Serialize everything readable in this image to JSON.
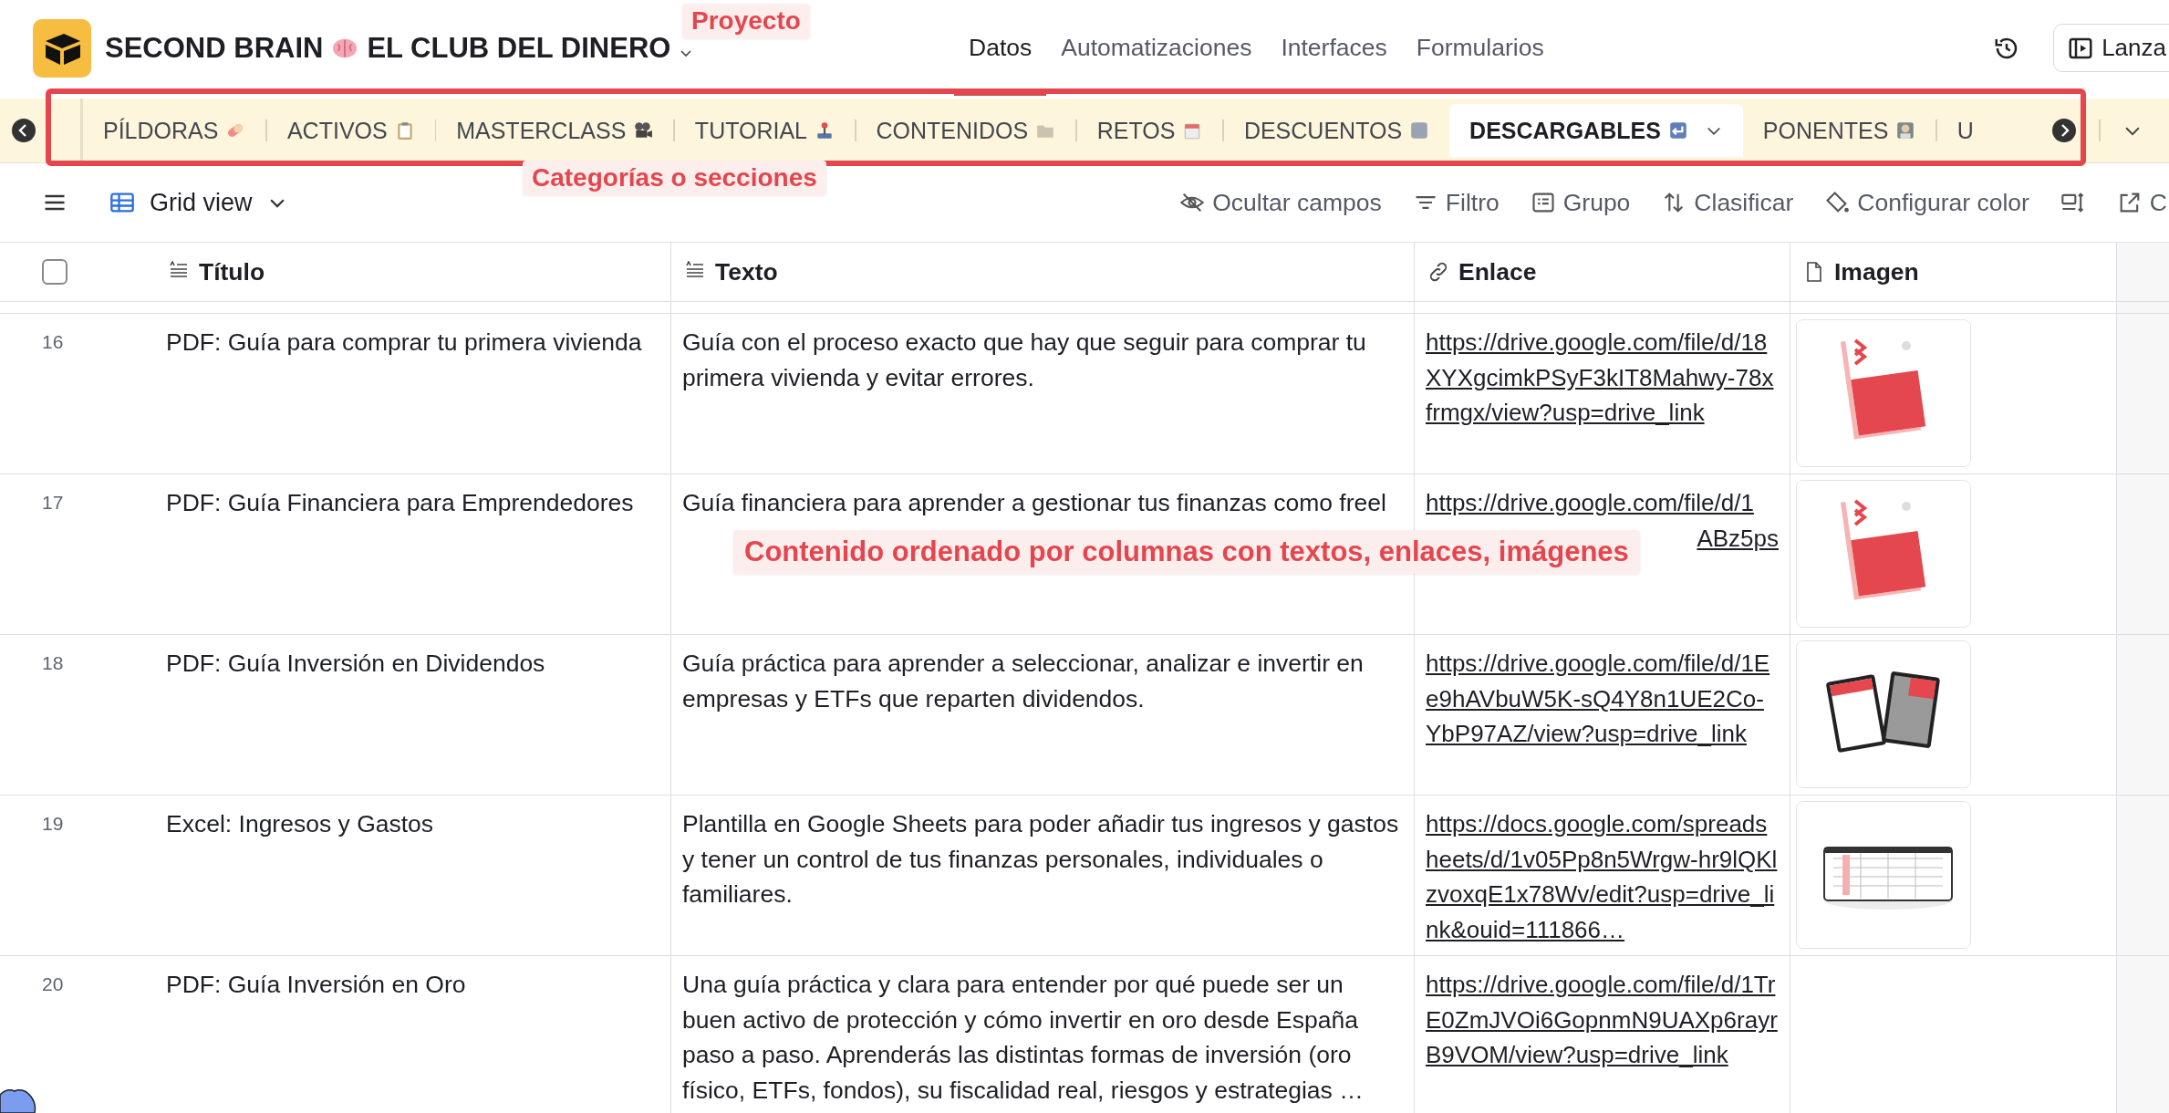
{
  "project": {
    "title_start": "SECOND BRAIN",
    "title_end": "EL CLUB DEL DINERO"
  },
  "nav": [
    {
      "label": "Datos",
      "selected": true
    },
    {
      "label": "Automatizaciones",
      "selected": false
    },
    {
      "label": "Interfaces",
      "selected": false
    },
    {
      "label": "Formularios",
      "selected": false
    }
  ],
  "launch_button": "Lanza",
  "tabs": [
    {
      "label": "PÍLDORAS",
      "selected": false
    },
    {
      "label": "ACTIVOS",
      "selected": false
    },
    {
      "label": "MASTERCLASS",
      "selected": false
    },
    {
      "label": "TUTORIAL",
      "selected": false
    },
    {
      "label": "CONTENIDOS",
      "selected": false
    },
    {
      "label": "RETOS",
      "selected": false
    },
    {
      "label": "DESCUENTOS",
      "selected": false
    },
    {
      "label": "DESCARGABLES",
      "selected": true
    },
    {
      "label": "PONENTES",
      "selected": false
    },
    {
      "label": "U",
      "selected": false
    }
  ],
  "view": {
    "name": "Grid view"
  },
  "toolbar": [
    "Ocultar campos",
    "Filtro",
    "Grupo",
    "Clasificar",
    "Configurar color"
  ],
  "share_button": "C",
  "table": {
    "select_all": {
      "checked": false
    },
    "columns": [
      "Título",
      "Texto",
      "Enlace",
      "Imagen"
    ],
    "rows": [
      {
        "number": "16",
        "title": "PDF: Guía para comprar tu primera vivienda",
        "text": "Guía con el proceso exacto que hay que seguir para comprar tu primera vivienda y evitar errores.",
        "link": "https://drive.google.com/file/d/18XYXgcimkPSyF3kIT8Mahwy-78xfrmgx/view?usp=drive_link"
      },
      {
        "number": "17",
        "title": "PDF: Guía Financiera para Emprendedores",
        "text": "Guía financiera para aprender a gestionar tus finanzas como freel",
        "link": "https://drive.google.com/file/d/1",
        "link_fragment": "ABz5ps"
      },
      {
        "number": "18",
        "title": "PDF: Guía Inversión en Dividendos",
        "text": "Guía práctica para aprender a seleccionar, analizar e invertir en empresas y ETFs que reparten dividendos.",
        "link": "https://drive.google.com/file/d/1Ee9hAVbuW5K-sQ4Y8n1UE2Co-YbP97AZ/view?usp=drive_link"
      },
      {
        "number": "19",
        "title": "Excel: Ingresos y Gastos",
        "text": "Plantilla en Google Sheets para poder añadir tus ingresos y gastos y tener un control de tus finanzas personales, individuales o familiares.",
        "link": "https://docs.google.com/spreadsheets/d/1v05Pp8n5Wrgw-hr9lQKlzvoxqE1x78Wv/edit?usp=drive_link&ouid=111866…"
      },
      {
        "number": "20",
        "title": "PDF: Guía Inversión en Oro",
        "text": "Una guía práctica y clara para entender por qué puede ser un buen activo de protección y cómo invertir en oro desde España paso a paso. Aprenderás las distintas formas de inversión (oro físico, ETFs, fondos), su fiscalidad real, riesgos y estrategias …",
        "link": "https://drive.google.com/file/d/1TrE0ZmJVOi6GopnmN9UAXp6rayrB9VOM/view?usp=drive_link"
      }
    ]
  },
  "annotations": [
    {
      "kind": "label",
      "text": "Proyecto"
    },
    {
      "kind": "frame"
    },
    {
      "kind": "label",
      "text": "Categorías o secciones"
    },
    {
      "kind": "label",
      "text": "Contenido ordenado por columnas con textos, enlaces, imágenes"
    }
  ]
}
